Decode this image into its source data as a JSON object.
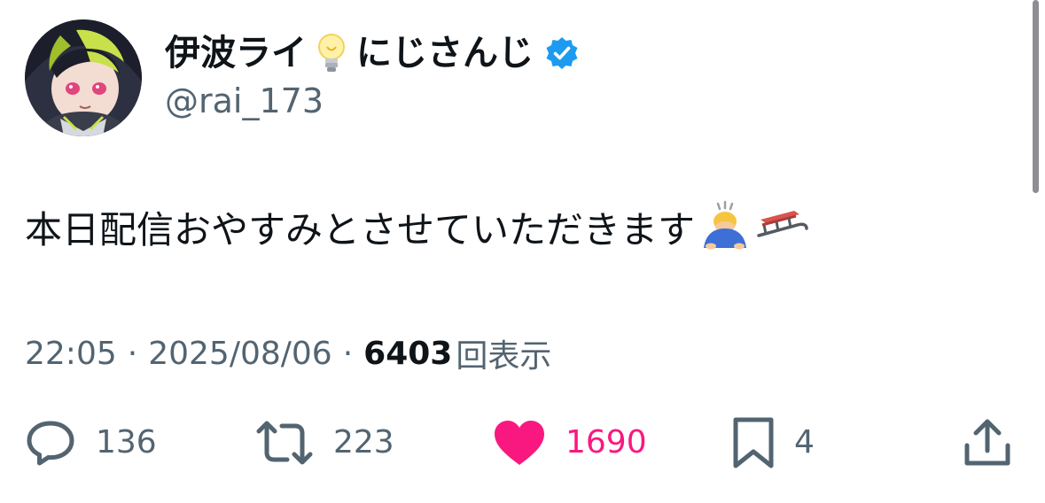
{
  "tweet": {
    "author": {
      "display_name": "伊波ライ",
      "affiliation": "にじさんじ",
      "handle": "@rai_173",
      "verified": true,
      "name_emoji": "light-bulb"
    },
    "text": "本日配信おやすみとさせていただきます",
    "trailing_emojis": [
      "person-bowing",
      "sled"
    ],
    "time": "22:05",
    "date": "2025/08/06",
    "separator": "·",
    "views_count": "6403",
    "views_label": "回表示"
  },
  "actions": {
    "reply": {
      "icon": "reply-icon",
      "count": "136"
    },
    "retweet": {
      "icon": "retweet-icon",
      "count": "223"
    },
    "like": {
      "icon": "heart-icon",
      "count": "1690",
      "active": true,
      "color": "#f91880"
    },
    "bookmark": {
      "icon": "bookmark-icon",
      "count": "4"
    },
    "share": {
      "icon": "share-icon"
    }
  },
  "colors": {
    "text_primary": "#0f1419",
    "text_secondary": "#536471",
    "verified_blue": "#1d9bf0",
    "like_pink": "#f91880"
  }
}
